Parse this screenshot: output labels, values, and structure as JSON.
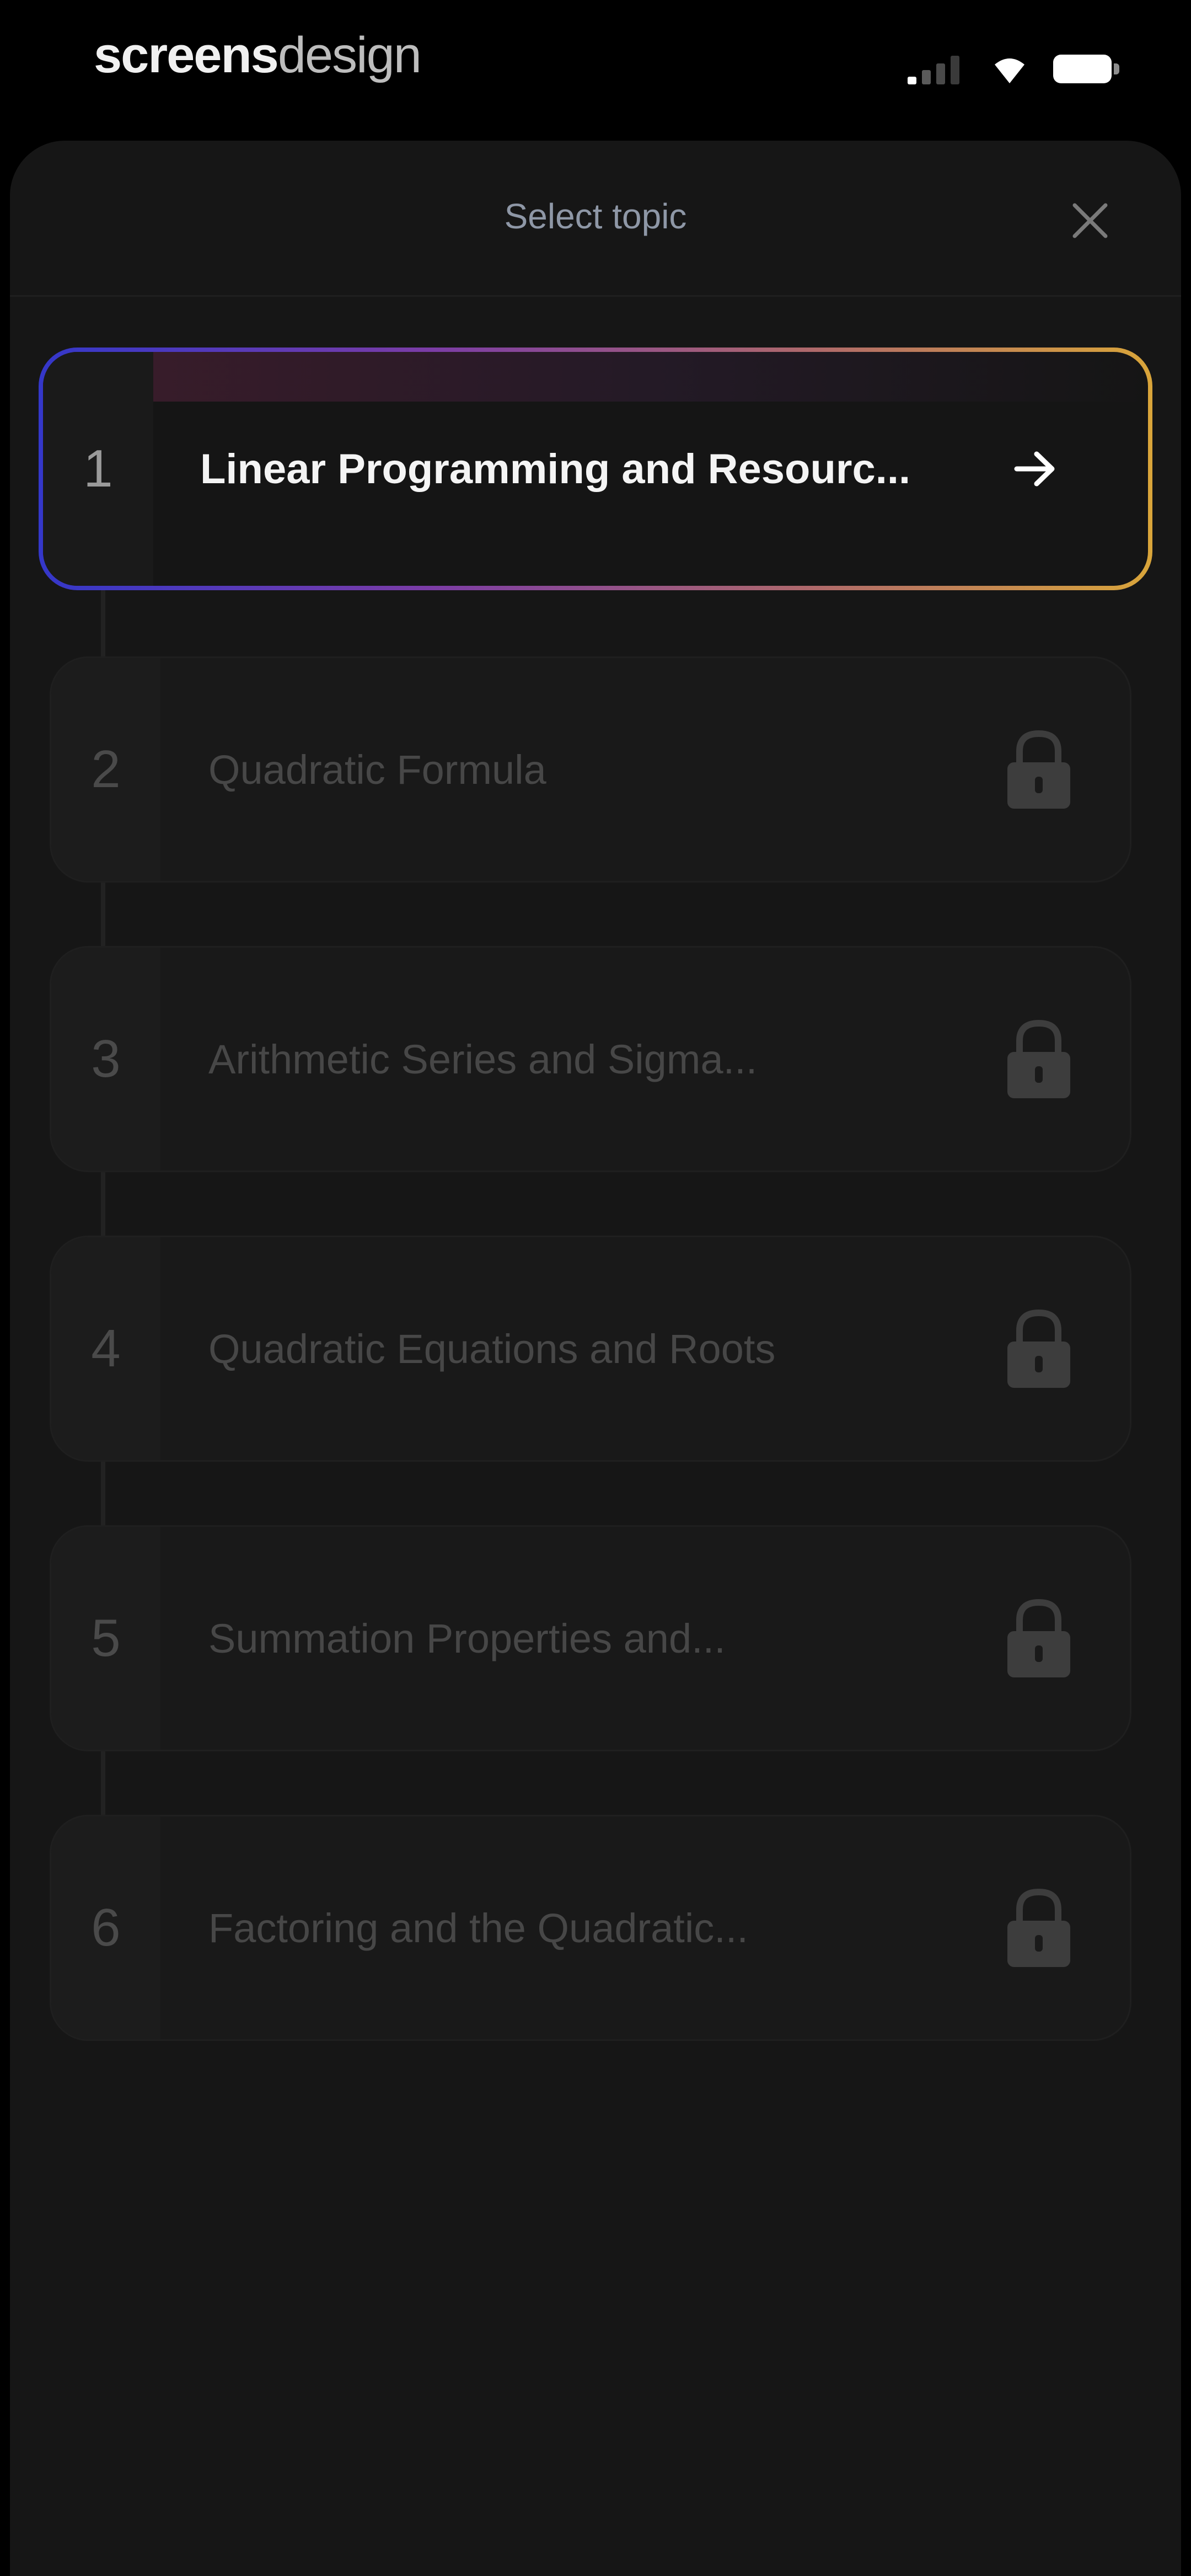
{
  "status_bar": {
    "watermark_bold": "screens",
    "watermark_light": "design",
    "icons": [
      "signal-icon",
      "wifi-icon",
      "battery-icon"
    ]
  },
  "sheet": {
    "title": "Select topic",
    "close_icon": "close-icon"
  },
  "topics": [
    {
      "number": "1",
      "label": "Linear Programming and Resourc...",
      "state": "active",
      "icon": "arrow-right-icon"
    },
    {
      "number": "2",
      "label": "Quadratic Formula",
      "state": "locked",
      "icon": "lock-icon"
    },
    {
      "number": "3",
      "label": "Arithmetic Series and Sigma...",
      "state": "locked",
      "icon": "lock-icon"
    },
    {
      "number": "4",
      "label": "Quadratic Equations and Roots",
      "state": "locked",
      "icon": "lock-icon"
    },
    {
      "number": "5",
      "label": "Summation Properties and...",
      "state": "locked",
      "icon": "lock-icon"
    },
    {
      "number": "6",
      "label": "Factoring and the Quadratic...",
      "state": "locked",
      "icon": "lock-icon"
    }
  ],
  "colors": {
    "background": "#000000",
    "sheet": "#161616",
    "card": "#191919",
    "gradient_start": "#3437c9",
    "gradient_mid": "#7b3ca6",
    "gradient_end": "#d9a53a"
  }
}
